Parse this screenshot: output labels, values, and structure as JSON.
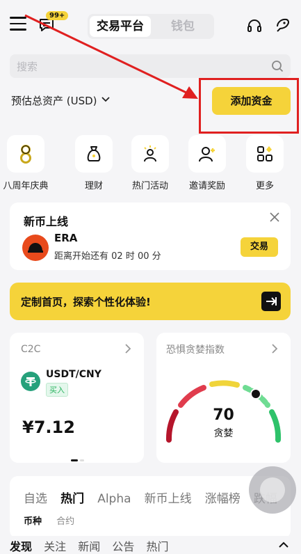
{
  "header": {
    "badge": "99+",
    "tabs": [
      "交易平台",
      "钱包"
    ]
  },
  "search": {
    "placeholder": "搜索"
  },
  "assets": {
    "label": "预估总资产 (USD)",
    "add_funds": "添加资金"
  },
  "quick_actions": [
    {
      "label": "八周年庆典",
      "icon": "eight-anniversary-icon"
    },
    {
      "label": "理财",
      "icon": "money-bag-icon"
    },
    {
      "label": "热门活动",
      "icon": "hot-activity-icon"
    },
    {
      "label": "邀请奖励",
      "icon": "invite-user-icon"
    },
    {
      "label": "更多",
      "icon": "grid-more-icon"
    }
  ],
  "new_coin": {
    "title": "新币上线",
    "coin": "ERA",
    "countdown": "距离开始还有 02 时 00 分",
    "trade": "交易"
  },
  "banner": {
    "text": "定制首页，探索个性化体验!"
  },
  "c2c": {
    "title": "C2C",
    "pair": "USDT/CNY",
    "badge": "买入",
    "price": "¥7.12"
  },
  "fear_greed": {
    "title": "恐惧贪婪指数",
    "value": "70",
    "label": "贪婪"
  },
  "market": {
    "tabs": [
      "自选",
      "热门",
      "Alpha",
      "新币上线",
      "涨幅榜",
      "跌幅"
    ],
    "sub_tabs": [
      "币种",
      "合约"
    ]
  },
  "bottom_tabs": [
    "发现",
    "关注",
    "新闻",
    "公告",
    "热门"
  ],
  "colors": {
    "accent": "#f5d33a",
    "highlight": "#e02020"
  }
}
